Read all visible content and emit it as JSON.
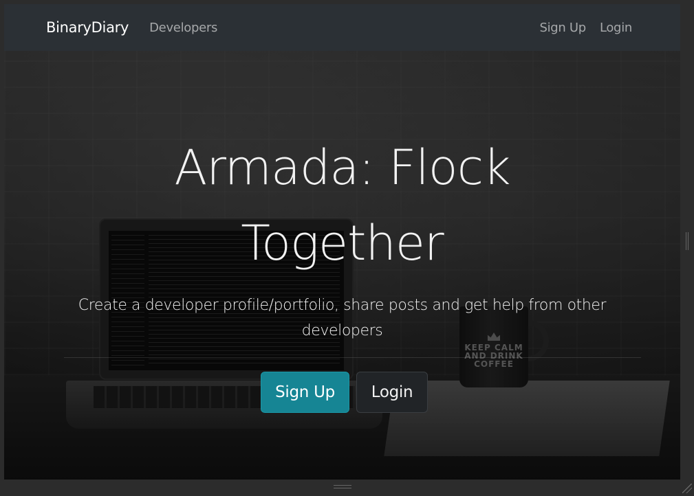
{
  "navbar": {
    "brand": "BinaryDiary",
    "links_left": [
      {
        "label": "Developers"
      }
    ],
    "links_right": [
      {
        "label": "Sign Up"
      },
      {
        "label": "Login"
      }
    ],
    "background_color": "#2b3035"
  },
  "hero": {
    "title": "Armada: Flock Together",
    "subtitle": "Create a developer profile/portfolio, share posts and get help from other developers",
    "primary_button": {
      "label": "Sign Up",
      "color": "#168594"
    },
    "secondary_button": {
      "label": "Login",
      "color": "#212427"
    }
  },
  "background": {
    "mug_text": "KEEP CALM AND DRINK COFFEE"
  },
  "icons": {
    "vertical_grip": "grip-lines-vertical-icon",
    "horizontal_grip": "grip-lines-horizontal-icon",
    "resize": "resize-corner-icon"
  }
}
